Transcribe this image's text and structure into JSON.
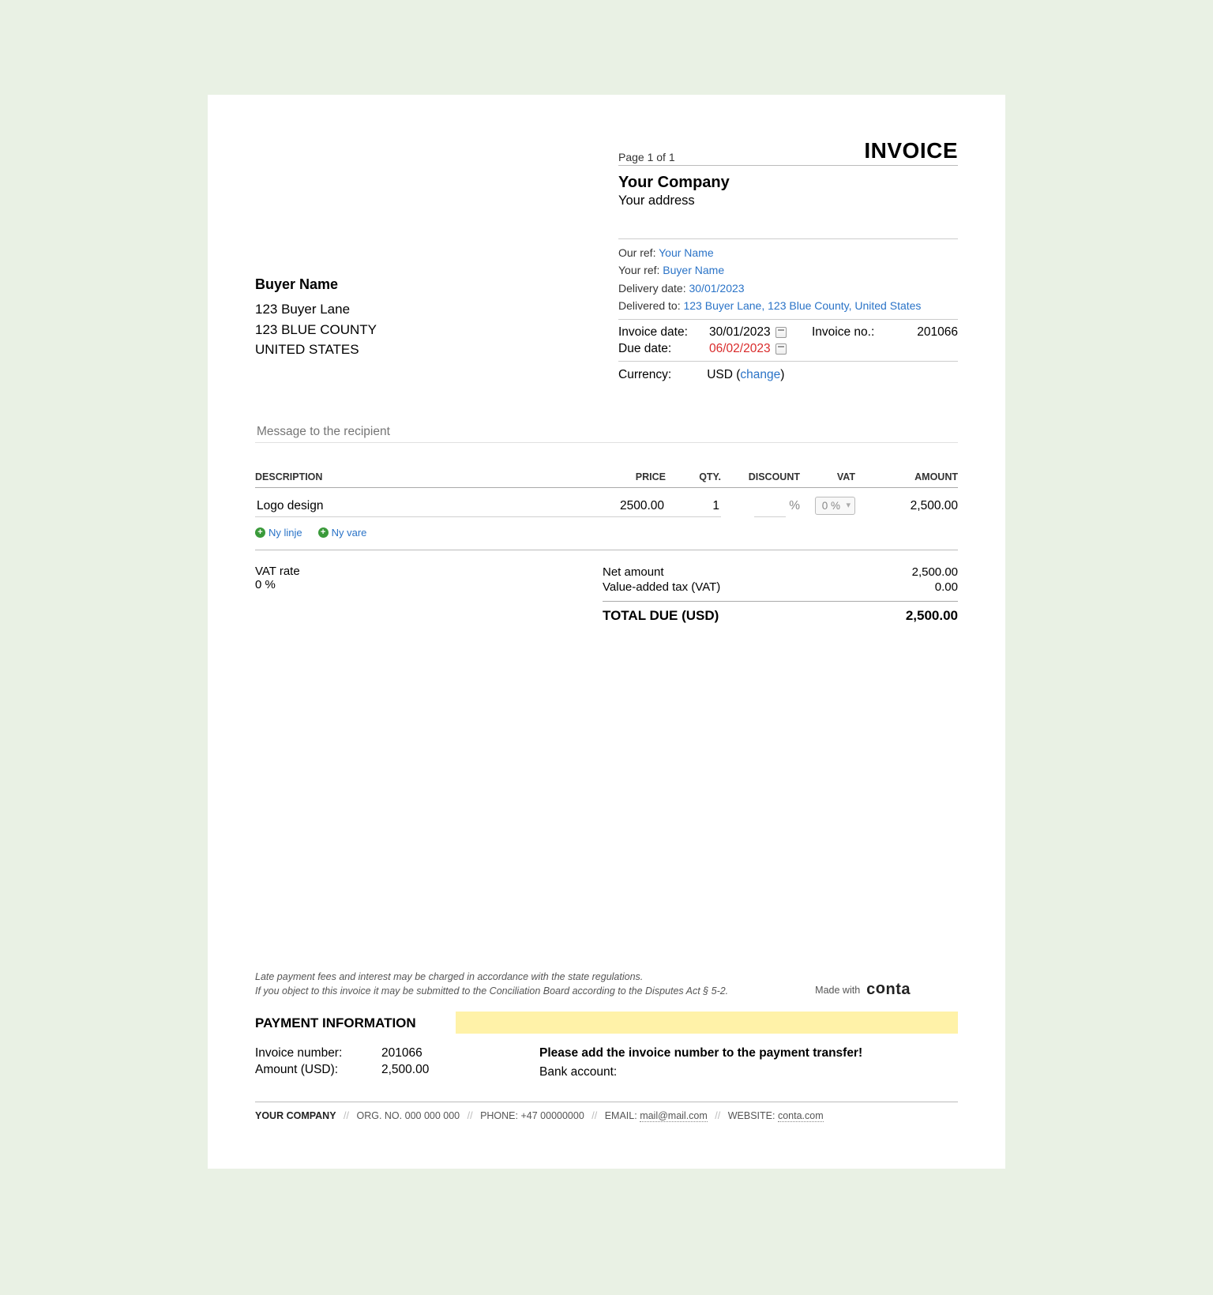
{
  "page_label": "Page 1 of 1",
  "doc_title": "INVOICE",
  "company": {
    "name": "Your Company",
    "address": "Your address"
  },
  "buyer": {
    "name": "Buyer Name",
    "line1": "123 Buyer Lane",
    "line2": "123 BLUE COUNTY",
    "line3": "UNITED STATES"
  },
  "refs": {
    "our_ref_label": "Our ref:",
    "our_ref": "Your Name",
    "your_ref_label": "Your ref:",
    "your_ref": "Buyer Name",
    "delivery_date_label": "Delivery date:",
    "delivery_date": "30/01/2023",
    "delivered_to_label": "Delivered to:",
    "delivered_to": "123 Buyer Lane, 123 Blue County, United States"
  },
  "meta": {
    "invoice_date_label": "Invoice date:",
    "invoice_date": "30/01/2023",
    "invoice_no_label": "Invoice no.:",
    "invoice_no": "201066",
    "due_date_label": "Due date:",
    "due_date": "06/02/2023"
  },
  "currency": {
    "label": "Currency:",
    "value": "USD",
    "change": "change"
  },
  "message_placeholder": "Message to the recipient",
  "columns": {
    "description": "DESCRIPTION",
    "price": "PRICE",
    "qty": "QTY.",
    "discount": "DISCOUNT",
    "vat": "VAT",
    "amount": "AMOUNT"
  },
  "line": {
    "description": "Logo design",
    "price": "2500.00",
    "qty": "1",
    "discount": "",
    "discount_suffix": "%",
    "vat_option": "0 %",
    "amount": "2,500.00"
  },
  "add": {
    "new_line": "Ny linje",
    "new_item": "Ny vare"
  },
  "vat_block": {
    "rate_label": "VAT rate",
    "rate": "0 %"
  },
  "totals": {
    "net_label": "Net amount",
    "net": "2,500.00",
    "vat_label": "Value-added tax (VAT)",
    "vat": "0.00",
    "total_label": "TOTAL DUE (USD)",
    "total": "2,500.00"
  },
  "disclaimer": {
    "l1": "Late payment fees and interest may be charged in accordance with the state regulations.",
    "l2": "If you object to this invoice it may be submitted to the Conciliation Board according to the Disputes Act § 5-2."
  },
  "madewith": {
    "label": "Made with",
    "brand": "conta"
  },
  "payment": {
    "heading": "PAYMENT INFORMATION",
    "invoice_no_label": "Invoice number:",
    "invoice_no": "201066",
    "amount_label": "Amount (USD):",
    "amount": "2,500.00",
    "notice": "Please add the invoice number to the payment transfer!",
    "bank_label": "Bank account:"
  },
  "footer": {
    "company": "YOUR COMPANY",
    "org_label": "ORG. NO.",
    "org": "000 000 000",
    "phone_label": "PHONE:",
    "phone": "+47 00000000",
    "email_label": "EMAIL:",
    "email": "mail@mail.com",
    "website_label": "WEBSITE:",
    "website": "conta.com"
  }
}
